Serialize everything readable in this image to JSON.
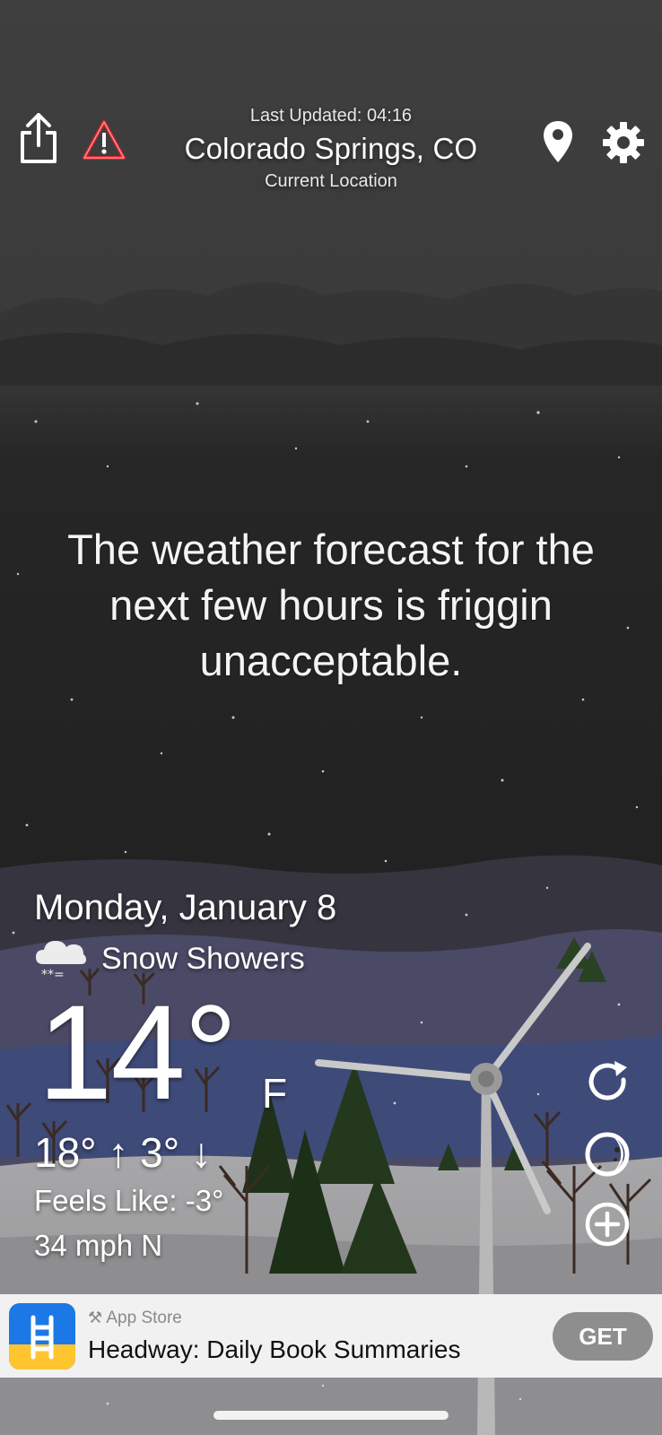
{
  "header": {
    "last_updated": "Last Updated: 04:16",
    "city": "Colorado Springs, CO",
    "location_label": "Current Location"
  },
  "message": "The weather forecast for the next few hours is friggin unacceptable.",
  "weather": {
    "date": "Monday, January 8",
    "condition": "Snow Showers",
    "condition_icon": "snow-cloud-icon",
    "temperature": "14°",
    "unit": "F",
    "hi_lo": "18° ↑ 3° ↓",
    "feels_like": "Feels Like: -3°",
    "wind": "34 mph N"
  },
  "ad": {
    "store_label": "App Store",
    "title": "Headway: Daily Book Summaries",
    "cta": "GET"
  },
  "colors": {
    "sky_top": "#3f3f3f",
    "sky_bottom": "#1e1e1e",
    "hills": "#4b4a66",
    "snow": "#9a9a9a",
    "alert_red": "#e0232b",
    "tree_green": "#23381c",
    "ad_bg": "#f1f1f1",
    "ad_cta": "#8e8e8e"
  }
}
